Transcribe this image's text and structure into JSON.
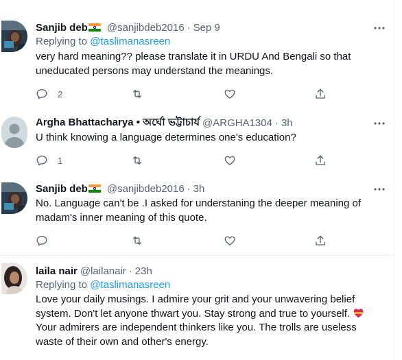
{
  "tweets": [
    {
      "name": "Sanjib deb",
      "flag": "india-flag",
      "handle": "@sanjibdeb2016",
      "time": "Sep 9",
      "replying_prefix": "Replying to",
      "replying_to": "@taslimanasreen",
      "text": "very hard meaning?? please translate it in URDU And Bengali so that uneducated persons may understand the meanings.",
      "reply_count": "2",
      "retweet_count": "",
      "like_count": ""
    },
    {
      "name": "Argha Bhattacharya • অর্ঘো ভট্টাচার্য",
      "handle": "@ARGHA1304",
      "time": "3h",
      "text": "U think knowing a language determines one's education?",
      "reply_count": "1",
      "retweet_count": "",
      "like_count": ""
    },
    {
      "name": "Sanjib deb",
      "flag": "india-flag",
      "handle": "@sanjibdeb2016",
      "time": "3h",
      "text": "No. Language can't be .I asked for understaning the deeper meaning of madam's inner meaning of this quote.",
      "reply_count": "",
      "retweet_count": "",
      "like_count": ""
    },
    {
      "name": "laila nair",
      "handle": "@lailanair",
      "time": "23h",
      "replying_prefix": "Replying to",
      "replying_to": "@taslimanasreen",
      "text": "Love your daily musings. I admire your grit and your unwavering belief system. Don't let anyone thwart you. Stay strong and true to yourself.",
      "text_emoji": "heart-ribbon-emoji",
      "text_2": "Your admirers are independent thinkers like you. The trolls are useless waste of their own and other's energy."
    }
  ],
  "separator": "·",
  "colors": {
    "link": "#1d9bf0",
    "secondary": "#536471",
    "primary_text": "#0f1419",
    "divider": "#eff3f4"
  }
}
